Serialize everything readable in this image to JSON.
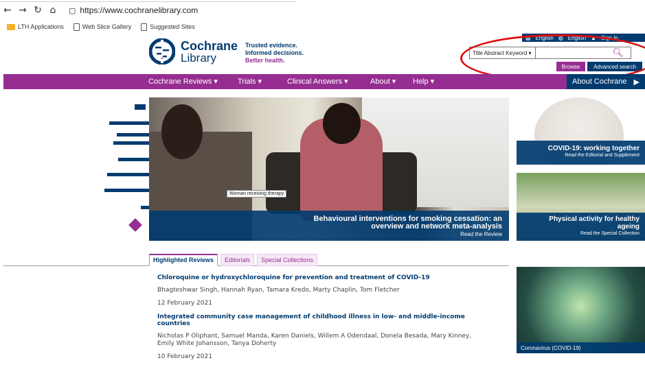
{
  "browser": {
    "url": "https://www.cochranelibrary.com",
    "favorites": [
      "LTH Applications",
      "Web Slice Gallery",
      "Suggested Sites"
    ]
  },
  "header": {
    "logo_line1": "Cochrane",
    "logo_line2": "Library",
    "tagline": [
      "Trusted evidence.",
      "Informed decisions.",
      "Better health."
    ],
    "lang1": "English",
    "lang2": "English",
    "signin": "Sign In"
  },
  "search": {
    "select_value": "Title Abstract Keyword ▾",
    "browse_label": "Browse",
    "advanced_label": "Advanced search"
  },
  "nav": {
    "items": [
      "Cochrane Reviews ▾",
      "Trials ▾",
      "Clinical Answers ▾",
      "About ▾",
      "Help ▾"
    ],
    "about_cochrane": "About Cochrane"
  },
  "hero": {
    "caption": "Woman receiving therapy",
    "title_l1": "Behavioural interventions for smoking cessation: an",
    "title_l2": "overview and network meta-analysis",
    "subtitle": "Read the Review"
  },
  "tiles": [
    {
      "title": "COVID-19: working together",
      "subtitle": "Read the Editorial and Supplement"
    },
    {
      "title_l1": "Physical activity for healthy",
      "title_l2": "ageing",
      "subtitle": "Read the Special Collection"
    },
    {
      "title": "Coronavirus (COVID-19)"
    }
  ],
  "tabs": [
    "Highlighted Reviews",
    "Editorials",
    "Special Collections"
  ],
  "reviews": [
    {
      "title": "Chloroquine or hydroxychloroquine for prevention and treatment of COVID-19",
      "authors": "Bhagteshwar Singh, Hannah Ryan, Tamara Kredo, Marty Chaplin, Tom Fletcher",
      "date": "12 February 2021"
    },
    {
      "title": "Integrated community case management of childhood illness in low- and middle-income countries",
      "authors": "Nicholas P Oliphant, Samuel Manda, Karen Daniels, Willem A Odendaal, Donela Besada, Mary Kinney, Emily White Johansson, Tanya Doherty",
      "date": "10 February 2021"
    }
  ],
  "colors": {
    "navy": "#003b6f",
    "purple": "#962d91",
    "annotation_red": "#e00d0d"
  }
}
